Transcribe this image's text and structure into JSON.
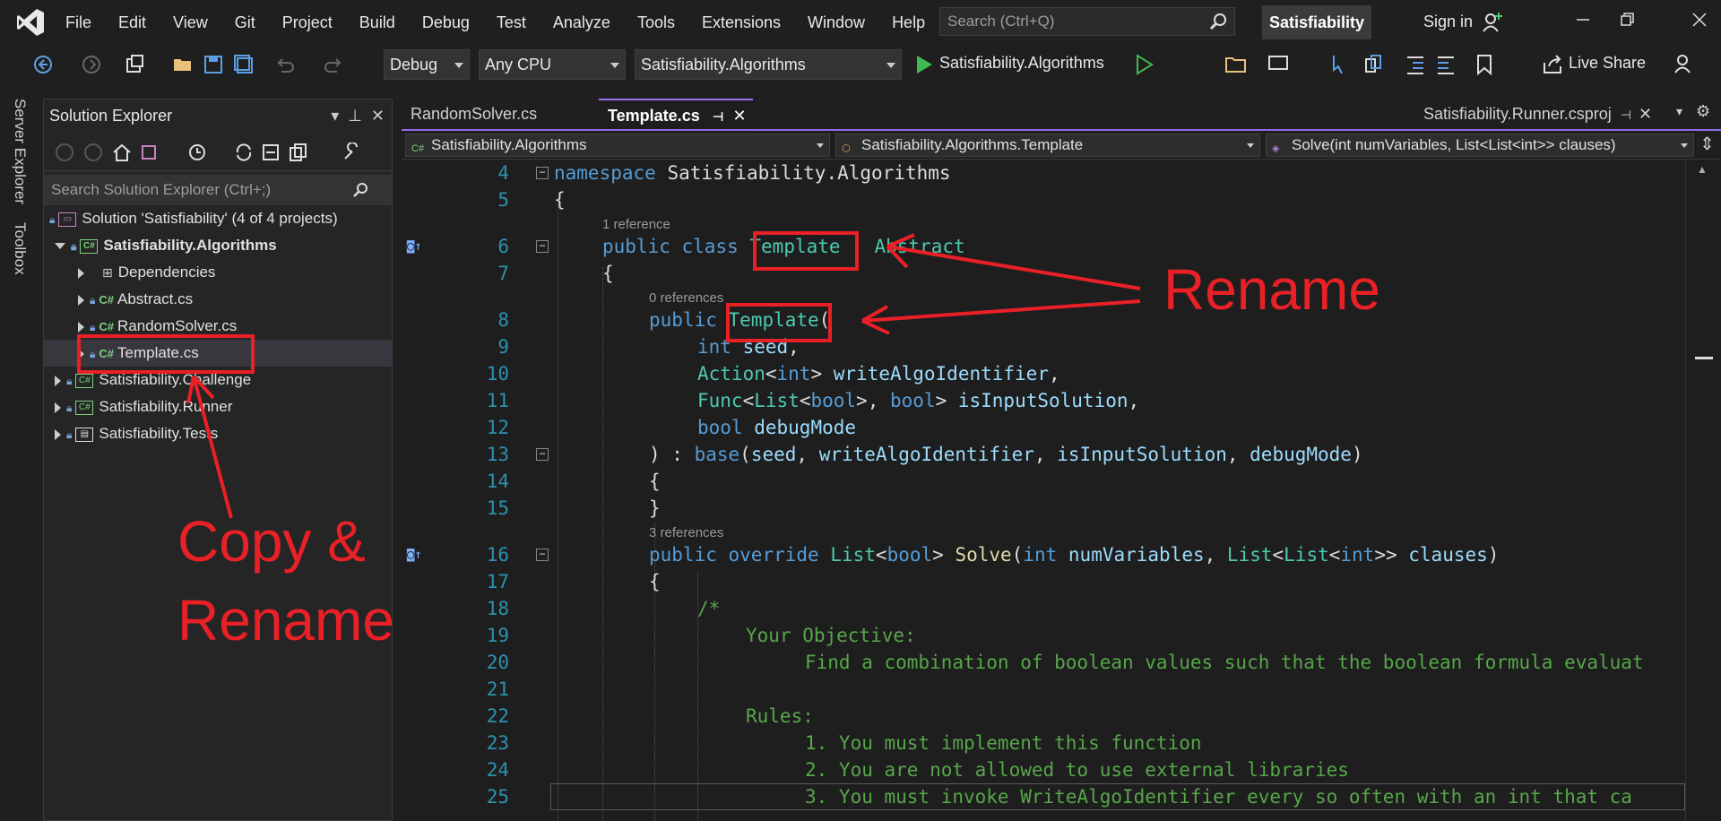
{
  "menu": [
    "File",
    "Edit",
    "View",
    "Git",
    "Project",
    "Build",
    "Debug",
    "Test",
    "Analyze",
    "Tools",
    "Extensions",
    "Window",
    "Help"
  ],
  "search": {
    "placeholder": "Search (Ctrl+Q)"
  },
  "solution_name": "Satisfiability",
  "signin": "Sign in",
  "toolbar": {
    "config": "Debug",
    "platform": "Any CPU",
    "startup_project": "Satisfiability.Algorithms",
    "run_label": "Satisfiability.Algorithms",
    "live_share": "Live Share"
  },
  "side_tabs": {
    "server_explorer": "Server Explorer",
    "toolbox": "Toolbox"
  },
  "solution_explorer": {
    "title": "Solution Explorer",
    "search_placeholder": "Search Solution Explorer (Ctrl+;)",
    "items": [
      {
        "label": "Solution 'Satisfiability' (4 of 4 projects)"
      },
      {
        "label": "Satisfiability.Algorithms"
      },
      {
        "label": "Dependencies"
      },
      {
        "label": "Abstract.cs"
      },
      {
        "label": "RandomSolver.cs"
      },
      {
        "label": "Template.cs"
      },
      {
        "label": "Satisfiability.Challenge"
      },
      {
        "label": "Satisfiability.Runner"
      },
      {
        "label": "Satisfiability.Tests"
      }
    ]
  },
  "tabs": {
    "tab1": "RandomSolver.cs",
    "tab2": "Template.cs",
    "right_tab": "Satisfiability.Runner.csproj"
  },
  "navbar": {
    "project": "Satisfiability.Algorithms",
    "type": "Satisfiability.Algorithms.Template",
    "member": "Solve(int numVariables, List<List<int>> clauses)"
  },
  "refs": {
    "r1": "1 reference",
    "r2": "0 references",
    "r3": "3 references"
  },
  "code": {
    "l4": "namespace Satisfiability.Algorithms",
    "comment_open": "/*",
    "c19": "Your Objective:",
    "c20": "Find a combination of boolean values such that the boolean formula evaluat",
    "c22": "Rules:",
    "c23": "1. You must implement this function",
    "c24": "2. You are not allowed to use external libraries",
    "c25": "3. You must invoke WriteAlgoIdentifier every so often with an int that ca"
  },
  "annotations": {
    "rename": "Rename",
    "copy1": "Copy &",
    "copy2": "Rename",
    "color": "#ea2027"
  }
}
